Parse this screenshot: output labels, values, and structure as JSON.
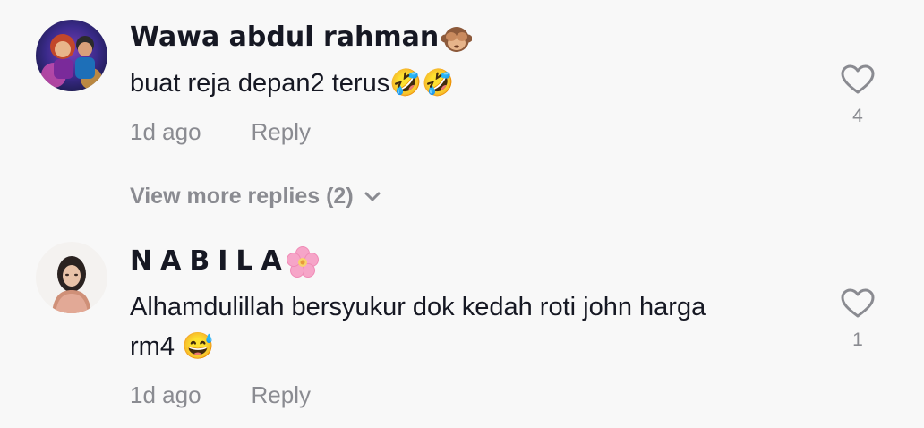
{
  "comments": [
    {
      "username": "Wawa abdul rahman",
      "username_emoji": "see-no-evil-monkey-emoji",
      "text_lines": [
        "buat reja depan2 terus🤣🤣"
      ],
      "time": "1d ago",
      "reply_label": "Reply",
      "like_count": "4"
    },
    {
      "username": "NABILA",
      "username_emoji": "cherry-blossom-emoji",
      "text_lines": [
        "Alhamdulillah bersyukur dok kedah roti john harga",
        "rm4 😅"
      ],
      "time": "1d ago",
      "reply_label": "Reply",
      "like_count": "1"
    }
  ],
  "view_more_replies": "View more replies (2)",
  "colors": {
    "background": "#f8f8f8",
    "primary_text": "#161823",
    "secondary_text": "#8a8b91"
  }
}
